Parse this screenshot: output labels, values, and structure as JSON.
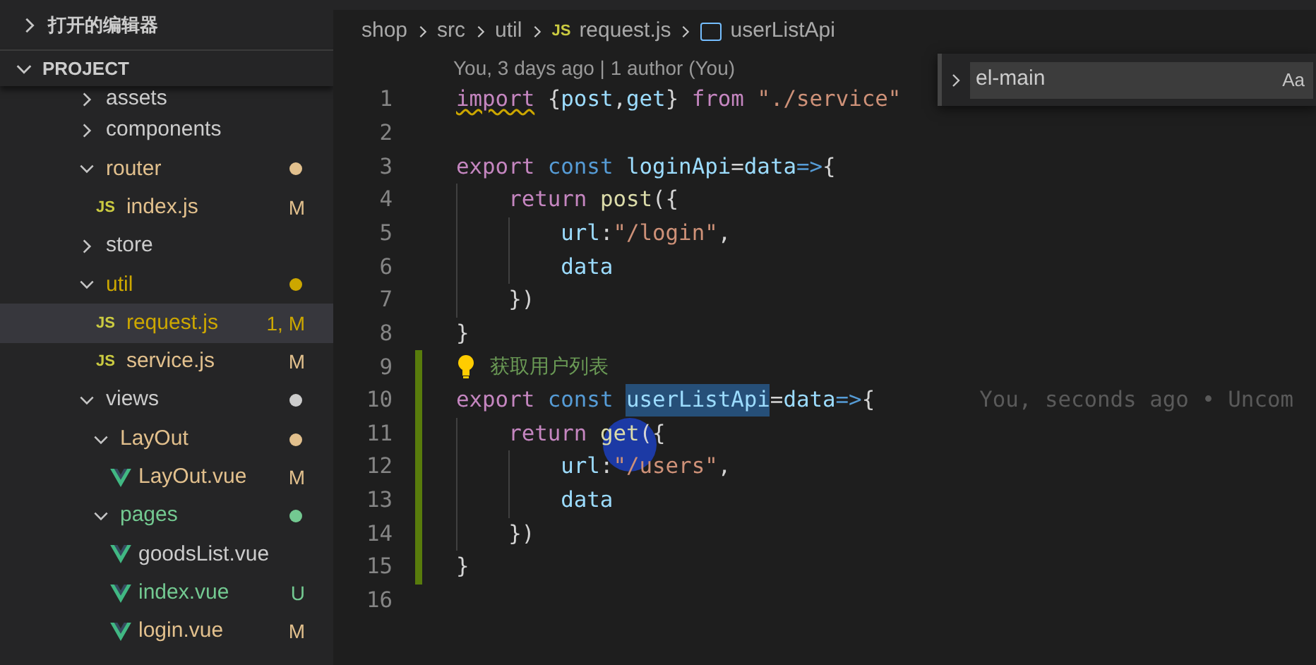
{
  "sidebar": {
    "open_editors": {
      "label": "打开的编辑器",
      "expanded": false
    },
    "project": {
      "label": "PROJECT",
      "expanded": true
    },
    "tree": [
      {
        "label": "assets",
        "kind": "folder",
        "expanded": false,
        "color": "#cccccc",
        "selected": false
      },
      {
        "label": "components",
        "kind": "folder",
        "expanded": false,
        "color": "#cccccc",
        "selected": false
      },
      {
        "label": "router",
        "kind": "folder",
        "expanded": true,
        "color": "#e2c08d",
        "dot": true,
        "selected": false,
        "children": [
          {
            "label": "index.js",
            "kind": "js",
            "icon_text": "JS",
            "color": "#e2c08d",
            "status": "M",
            "selected": false
          }
        ]
      },
      {
        "label": "store",
        "kind": "folder",
        "expanded": false,
        "color": "#cccccc",
        "selected": false
      },
      {
        "label": "util",
        "kind": "folder",
        "expanded": true,
        "color": "#cca700",
        "dot": true,
        "selected": false,
        "children": [
          {
            "label": "request.js",
            "kind": "js",
            "icon_text": "JS",
            "color": "#cca700",
            "status": "1, M",
            "selected": true
          },
          {
            "label": "service.js",
            "kind": "js",
            "icon_text": "JS",
            "color": "#e2c08d",
            "status": "M",
            "selected": false
          }
        ]
      },
      {
        "label": "views",
        "kind": "folder",
        "expanded": true,
        "color": "#cccccc",
        "dot": true,
        "selected": false,
        "children": [
          {
            "label": "LayOut",
            "kind": "folder",
            "expanded": true,
            "color": "#e2c08d",
            "dot": true,
            "selected": false,
            "children": [
              {
                "label": "LayOut.vue",
                "kind": "vue",
                "color": "#e2c08d",
                "status": "M",
                "selected": false
              }
            ]
          },
          {
            "label": "pages",
            "kind": "folder",
            "expanded": true,
            "color": "#73c991",
            "dot": true,
            "selected": false,
            "children": [
              {
                "label": "goodsList.vue",
                "kind": "vue",
                "color": "#cccccc",
                "selected": false
              },
              {
                "label": "index.vue",
                "kind": "vue",
                "color": "#73c991",
                "status": "U",
                "selected": false
              },
              {
                "label": "login.vue",
                "kind": "vue",
                "color": "#e2c08d",
                "status": "M",
                "selected": false
              }
            ]
          }
        ]
      }
    ]
  },
  "breadcrumb": [
    {
      "label": "shop",
      "kind": "folder"
    },
    {
      "label": "src",
      "kind": "folder"
    },
    {
      "label": "util",
      "kind": "folder"
    },
    {
      "label": "request.js",
      "kind": "js",
      "icon_text": "JS"
    },
    {
      "label": "userListApi",
      "kind": "symbol"
    }
  ],
  "codelens": "You, 3 days ago | 1 author (You)",
  "find": {
    "value": "el-main",
    "expanded": false,
    "match_case": "Aa"
  },
  "lines": [
    {
      "number": "1",
      "changed": false,
      "tokens": [
        {
          "t": "import",
          "kind": "kw",
          "squiggle": true
        },
        {
          "t": " {",
          "kind": "p"
        },
        {
          "t": "post",
          "kind": "var"
        },
        {
          "t": ",",
          "kind": "p"
        },
        {
          "t": "get",
          "kind": "var"
        },
        {
          "t": "} ",
          "kind": "p"
        },
        {
          "t": "from",
          "kind": "kw"
        },
        {
          "t": " \"./service\"",
          "kind": "str"
        }
      ]
    },
    {
      "number": "2",
      "changed": false
    },
    {
      "number": "3",
      "changed": false,
      "tokens": [
        {
          "t": "export",
          "kind": "kw"
        },
        {
          "t": " const",
          "kind": "st"
        },
        {
          "t": " loginApi",
          "kind": "var"
        },
        {
          "t": "=",
          "kind": "p"
        },
        {
          "t": "data",
          "kind": "var"
        },
        {
          "t": "=>",
          "kind": "st"
        },
        {
          "t": "{",
          "kind": "p"
        }
      ]
    },
    {
      "number": "4",
      "changed": false,
      "tokens": [
        {
          "t": "    return",
          "kind": "kw"
        },
        {
          "t": " post",
          "kind": "fn"
        },
        {
          "t": "({",
          "kind": "p"
        }
      ]
    },
    {
      "number": "5",
      "changed": false,
      "tokens": [
        {
          "t": "        url",
          "kind": "var"
        },
        {
          "t": ":",
          "kind": "p"
        },
        {
          "t": "\"/login\"",
          "kind": "str"
        },
        {
          "t": ",",
          "kind": "p"
        }
      ]
    },
    {
      "number": "6",
      "changed": false,
      "tokens": [
        {
          "t": "        data",
          "kind": "var"
        }
      ]
    },
    {
      "number": "7",
      "changed": false,
      "tokens": [
        {
          "t": "    })",
          "kind": "p"
        }
      ]
    },
    {
      "number": "8",
      "changed": false,
      "tokens": [
        {
          "t": "}",
          "kind": "p"
        }
      ]
    },
    {
      "number": "9",
      "changed": true,
      "lightbulb": true,
      "tokens": [
        {
          "t": "获取用户列表",
          "kind": "cm"
        }
      ]
    },
    {
      "number": "10",
      "changed": true,
      "blame": "You, seconds ago • Uncom",
      "tokens": [
        {
          "t": "export",
          "kind": "kw"
        },
        {
          "t": " const ",
          "kind": "st"
        },
        {
          "t": "userListApi",
          "kind": "var",
          "selected": true
        },
        {
          "t": "=",
          "kind": "p"
        },
        {
          "t": "data",
          "kind": "var"
        },
        {
          "t": "=>",
          "kind": "st"
        },
        {
          "t": "{",
          "kind": "p"
        }
      ]
    },
    {
      "number": "11",
      "changed": true,
      "tokens": [
        {
          "t": "    return",
          "kind": "kw"
        },
        {
          "t": " get",
          "kind": "fn"
        },
        {
          "t": "({",
          "kind": "p"
        }
      ]
    },
    {
      "number": "12",
      "changed": true,
      "tokens": [
        {
          "t": "        url",
          "kind": "var"
        },
        {
          "t": ":",
          "kind": "p"
        },
        {
          "t": "\"/users\"",
          "kind": "str"
        },
        {
          "t": ",",
          "kind": "p"
        }
      ]
    },
    {
      "number": "13",
      "changed": true,
      "tokens": [
        {
          "t": "        data",
          "kind": "var"
        }
      ]
    },
    {
      "number": "14",
      "changed": true,
      "tokens": [
        {
          "t": "    })",
          "kind": "p"
        }
      ]
    },
    {
      "number": "15",
      "changed": true,
      "tokens": [
        {
          "t": "}",
          "kind": "p"
        }
      ]
    },
    {
      "number": "16",
      "changed": false
    }
  ]
}
